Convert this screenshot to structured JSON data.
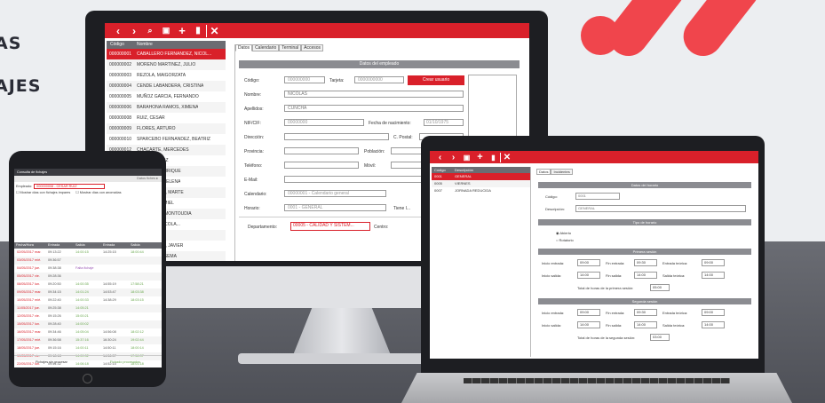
{
  "headline": {
    "line1": "AS",
    "line2": "AJES"
  },
  "monitor": {
    "toolbar": [
      "‹",
      "›",
      "🔍",
      "💾",
      "+",
      "🗑",
      "✕"
    ],
    "list_headers": [
      "Código",
      "Nombre"
    ],
    "list_rows": [
      [
        "000000001",
        "CABALLERO FERNANDEZ, NICOL..."
      ],
      [
        "000000002",
        "MORENO MARTINEZ, JULIO"
      ],
      [
        "000000003",
        "REZOLA, MAIGORZATA"
      ],
      [
        "000000004",
        "CENDE LABANDERA, CRISTINA"
      ],
      [
        "000000005",
        "MUÑOZ GARCIA, FERNANDO"
      ],
      [
        "000000006",
        "BARAHONA RAMOS, XIMENA"
      ],
      [
        "000000008",
        "RUIZ, CESAR"
      ],
      [
        "000000009",
        "FLORES, ARTURO"
      ],
      [
        "000000010",
        "SPARCEBO FERNANDEZ, BEATRIZ"
      ],
      [
        "000000012",
        "CHACARTE, MERCEDES"
      ],
      [
        "",
        "...FARA, MIRAZ"
      ],
      [
        "",
        "...FLORES, ENRIQUE"
      ],
      [
        "",
        "...GRIENSEN, ELENA"
      ],
      [
        "",
        "...MAROUZAS, MARTE"
      ],
      [
        "",
        "...LÓPEZ, CAMIEL"
      ],
      [
        "",
        "...CAMACHO MONTOUDIA"
      ],
      [
        "",
        "...RUENTE NICOLA..."
      ],
      [
        "",
        "...MAR, CELIA"
      ],
      [
        "",
        "...MARCADOL, JAVIER"
      ],
      [
        "",
        "...FUERTES, GEMA"
      ]
    ],
    "tabs": [
      "Datos",
      "Calendario",
      "Terminal",
      "Accesos"
    ],
    "section_title": "Datos del empleado",
    "fields": {
      "codigo_label": "Código:",
      "codigo_value": "000000000",
      "tarjeta_label": "Tarjeta:",
      "tarjeta_value": "0000000000",
      "crear_button": "Crear usuario",
      "nombre_label": "Nombre:",
      "nombre_value": "NICOLAS",
      "apellidos_label": "Apellidos:",
      "apellidos_value": "CUNCHA",
      "nif_label": "NIF/CIF:",
      "nif_value": "00000000",
      "nacimiento_label": "Fecha de nacimiento:",
      "nacimiento_value": "01/10/1975",
      "direccion_label": "Dirección:",
      "cpostal_label": "C. Postal:",
      "provincia_label": "Provincia:",
      "poblacion_label": "Población:",
      "telefono_label": "Teléfono:",
      "movil_label": "Móvil:",
      "email_label": "E-Mail:",
      "calendario_label": "Calendario:",
      "calendario_value": "00000001 - Calendario general",
      "horario_label": "Horario:",
      "horario_value": "0001 - GENERAL",
      "tiene_label": "Tiene l...",
      "departamento_label": "Departamento:",
      "departamento_value": "00005 - CALIDAD Y SISTEM...",
      "centro_label": "Centro:"
    }
  },
  "tablet": {
    "title": "Consulta de fichajes",
    "empleado_label": "Empleado:",
    "empleado_value": "000000008 - CESAR RUIZ",
    "check1": "Mostrar días con fichajes impares",
    "check2": "Mostrar días con anomalías",
    "headers": [
      "Fecha/Hora",
      "Entrada",
      "Salida",
      "Entrada",
      "Salida"
    ],
    "rows": [
      [
        "02/05/2017 mar.",
        "09:13:22",
        "14:00:15",
        "14:25:15",
        "18:00:44"
      ],
      [
        "03/05/2017 mié.",
        "09:36:57",
        "",
        "",
        ""
      ],
      [
        "04/05/2017 jue.",
        "09:38:38",
        "Falta fichaje",
        "",
        ""
      ],
      [
        "05/05/2017 vie.",
        "09:28:36",
        "",
        "",
        ""
      ],
      [
        "08/05/2017 lun.",
        "09:20:50",
        "14:00:35",
        "14:55:19",
        "17:58:21"
      ],
      [
        "09/05/2017 mar.",
        "09:34:15",
        "14:01:24",
        "14:53:47",
        "18:03:38"
      ],
      [
        "10/05/2017 mié.",
        "09:22:40",
        "14:00:33",
        "14:38:29",
        "18:03:15"
      ],
      [
        "11/05/2017 jue.",
        "09:25:38",
        "14:05:21",
        "",
        ""
      ],
      [
        "12/05/2017 vie.",
        "09:15:26",
        "15:00:21",
        "",
        ""
      ],
      [
        "15/05/2017 lun.",
        "09:28:40",
        "14:00:02",
        "",
        ""
      ],
      [
        "16/05/2017 mar.",
        "09:34:46",
        "14:05:04",
        "14:56:08",
        "18:02:12"
      ],
      [
        "17/05/2017 mié.",
        "09:36:58",
        "15:37:16",
        "16:30:24",
        "19:02:44"
      ],
      [
        "18/05/2017 jue.",
        "09:15:16",
        "14:00:11",
        "14:50:11",
        "18:00:14"
      ],
      [
        "19/05/2017 vie.",
        "09:18:18",
        "14:00:32",
        "14:56:57",
        "17:58:37"
      ],
      [
        "22/05/2017 lun.",
        "09:44:32",
        "14:06:18",
        "14:52:15",
        "18:01:18"
      ]
    ],
    "footer_left": "Fichajes sin procesar",
    "footer_right": "Fichado procesados"
  },
  "laptop": {
    "toolbar": [
      "‹",
      "›",
      "💾",
      "+",
      "🗑",
      "✕"
    ],
    "list_headers": [
      "Código",
      "Descripción"
    ],
    "list_rows": [
      [
        "0001",
        "GENERAL"
      ],
      [
        "0005",
        "VIERNES"
      ],
      [
        "0007",
        "JORNADA REDUCIDA"
      ]
    ],
    "tabs": [
      "Datos",
      "Incidentes"
    ],
    "sect_datos": "Datos del horario",
    "codigo_label": "Código:",
    "codigo_value": "0001",
    "descripcion_label": "Descripción:",
    "descripcion_value": "GENERAL",
    "sect_tipo": "Tipo de horario",
    "radio1": "Abierto",
    "radio2": "Rotatorio",
    "sect_p1": "Primera sesión",
    "sect_p2": "Segunda sesión",
    "inicio_entrada": "Inicio entrada:",
    "fin_entrada": "Fin entrada:",
    "entrada_teorica": "Entrada teórica:",
    "inicio_salida": "Inicio salida:",
    "fin_salida": "Fin salida:",
    "salida_teorica": "Salida teórica:",
    "total1": "Total de horas de la primera sesión:",
    "total2": "Total de horas de la segunda sesión:",
    "p1": {
      "ie": "09:00",
      "fe": "09:30",
      "et": "09:00",
      "is": "14:00",
      "fs": "14:00",
      "st": "14:00",
      "total": "05:00"
    },
    "p2": {
      "ie": "09:00",
      "fe": "09:30",
      "et": "09:00",
      "is": "14:00",
      "fs": "14:00",
      "st": "14:00",
      "total": "03:00"
    }
  }
}
